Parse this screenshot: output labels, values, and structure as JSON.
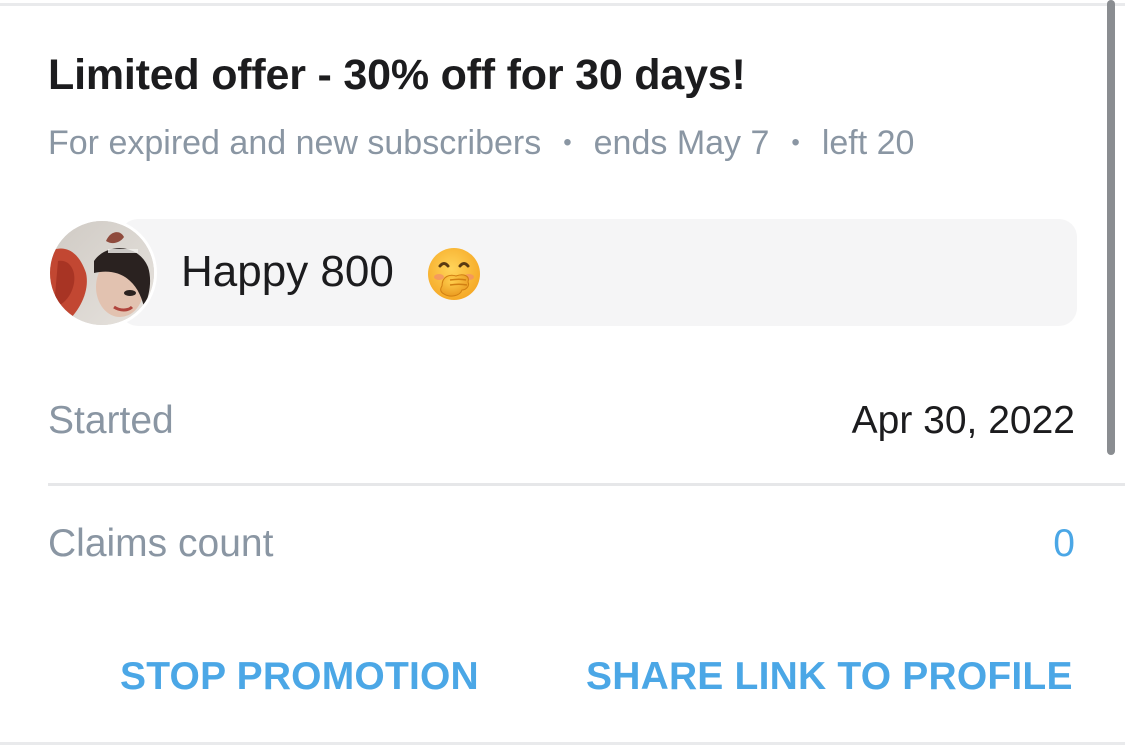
{
  "promotion": {
    "title": "Limited offer - 30% off for 30 days!",
    "audience": "For expired and new subscribers",
    "ends": "ends May 7",
    "left": "left 20",
    "separator": "•"
  },
  "message": {
    "text": "Happy 800",
    "emoji": "hand-over-mouth-emoji"
  },
  "details": {
    "started_label": "Started",
    "started_value": "Apr 30, 2022",
    "claims_label": "Claims count",
    "claims_value": "0"
  },
  "actions": {
    "stop_label": "STOP PROMOTION",
    "share_label": "SHARE LINK TO PROFILE"
  },
  "colors": {
    "accent": "#4ba7e6",
    "muted_text": "#8a96a3",
    "primary_text": "#1c1c1e",
    "bubble_bg": "#f5f5f6"
  }
}
